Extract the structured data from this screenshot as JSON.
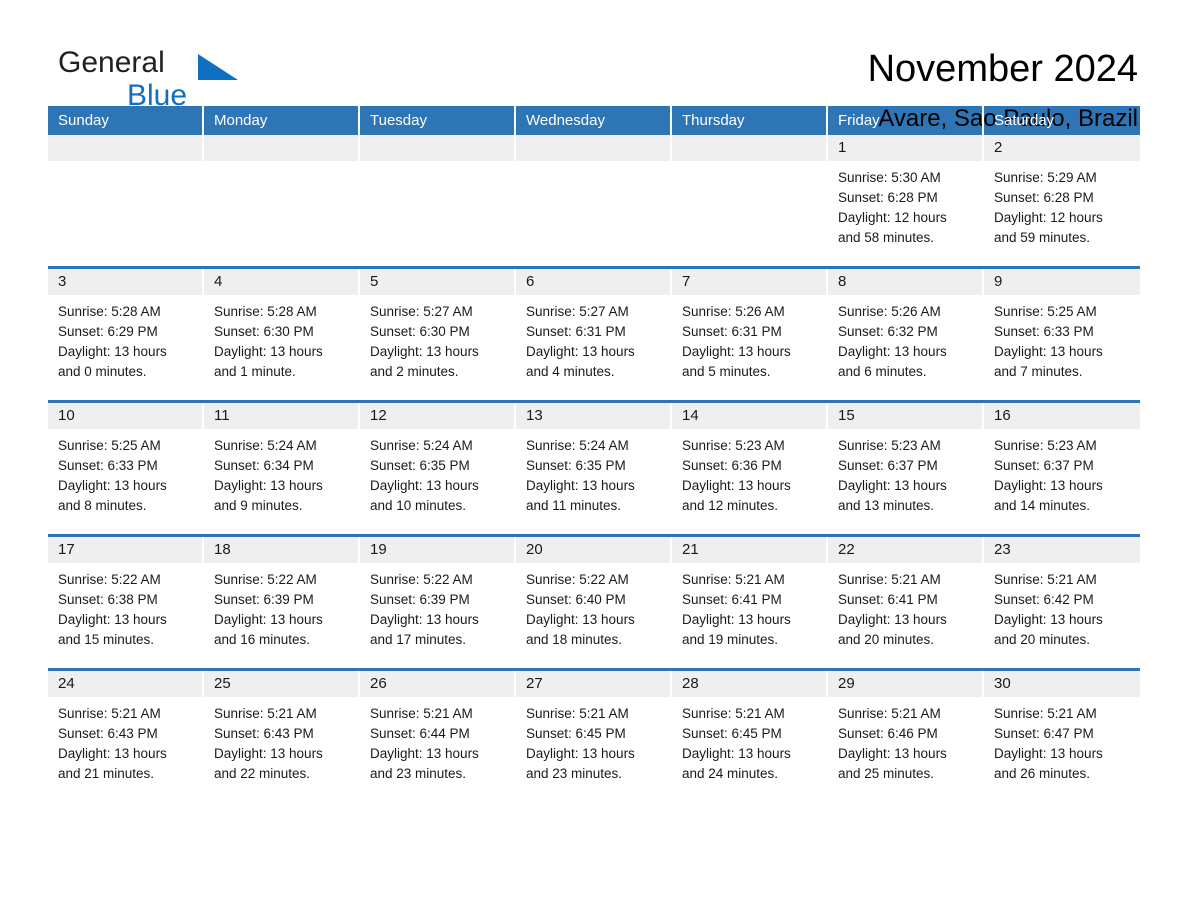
{
  "brand": {
    "name_part1": "General",
    "name_part2": "Blue",
    "triangle_color": "#0f6fc0"
  },
  "header": {
    "title": "November 2024",
    "subtitle": "Avare, Sao Paulo, Brazil"
  },
  "theme": {
    "header_bg": "#2e75b6",
    "header_text": "#ffffff",
    "daynum_bg": "#efefef",
    "row_divider": "#2e75b6",
    "cell_bg": "#ffffff"
  },
  "weekday_headers": [
    "Sunday",
    "Monday",
    "Tuesday",
    "Wednesday",
    "Thursday",
    "Friday",
    "Saturday"
  ],
  "labels": {
    "sunrise_prefix": "Sunrise:",
    "sunset_prefix": "Sunset:",
    "daylight_prefix": "Daylight:"
  },
  "weeks": [
    [
      {
        "day": "",
        "lines": []
      },
      {
        "day": "",
        "lines": []
      },
      {
        "day": "",
        "lines": []
      },
      {
        "day": "",
        "lines": []
      },
      {
        "day": "",
        "lines": []
      },
      {
        "day": "1",
        "lines": [
          "Sunrise: 5:30 AM",
          "Sunset: 6:28 PM",
          "Daylight: 12 hours",
          "and 58 minutes."
        ]
      },
      {
        "day": "2",
        "lines": [
          "Sunrise: 5:29 AM",
          "Sunset: 6:28 PM",
          "Daylight: 12 hours",
          "and 59 minutes."
        ]
      }
    ],
    [
      {
        "day": "3",
        "lines": [
          "Sunrise: 5:28 AM",
          "Sunset: 6:29 PM",
          "Daylight: 13 hours",
          "and 0 minutes."
        ]
      },
      {
        "day": "4",
        "lines": [
          "Sunrise: 5:28 AM",
          "Sunset: 6:30 PM",
          "Daylight: 13 hours",
          "and 1 minute."
        ]
      },
      {
        "day": "5",
        "lines": [
          "Sunrise: 5:27 AM",
          "Sunset: 6:30 PM",
          "Daylight: 13 hours",
          "and 2 minutes."
        ]
      },
      {
        "day": "6",
        "lines": [
          "Sunrise: 5:27 AM",
          "Sunset: 6:31 PM",
          "Daylight: 13 hours",
          "and 4 minutes."
        ]
      },
      {
        "day": "7",
        "lines": [
          "Sunrise: 5:26 AM",
          "Sunset: 6:31 PM",
          "Daylight: 13 hours",
          "and 5 minutes."
        ]
      },
      {
        "day": "8",
        "lines": [
          "Sunrise: 5:26 AM",
          "Sunset: 6:32 PM",
          "Daylight: 13 hours",
          "and 6 minutes."
        ]
      },
      {
        "day": "9",
        "lines": [
          "Sunrise: 5:25 AM",
          "Sunset: 6:33 PM",
          "Daylight: 13 hours",
          "and 7 minutes."
        ]
      }
    ],
    [
      {
        "day": "10",
        "lines": [
          "Sunrise: 5:25 AM",
          "Sunset: 6:33 PM",
          "Daylight: 13 hours",
          "and 8 minutes."
        ]
      },
      {
        "day": "11",
        "lines": [
          "Sunrise: 5:24 AM",
          "Sunset: 6:34 PM",
          "Daylight: 13 hours",
          "and 9 minutes."
        ]
      },
      {
        "day": "12",
        "lines": [
          "Sunrise: 5:24 AM",
          "Sunset: 6:35 PM",
          "Daylight: 13 hours",
          "and 10 minutes."
        ]
      },
      {
        "day": "13",
        "lines": [
          "Sunrise: 5:24 AM",
          "Sunset: 6:35 PM",
          "Daylight: 13 hours",
          "and 11 minutes."
        ]
      },
      {
        "day": "14",
        "lines": [
          "Sunrise: 5:23 AM",
          "Sunset: 6:36 PM",
          "Daylight: 13 hours",
          "and 12 minutes."
        ]
      },
      {
        "day": "15",
        "lines": [
          "Sunrise: 5:23 AM",
          "Sunset: 6:37 PM",
          "Daylight: 13 hours",
          "and 13 minutes."
        ]
      },
      {
        "day": "16",
        "lines": [
          "Sunrise: 5:23 AM",
          "Sunset: 6:37 PM",
          "Daylight: 13 hours",
          "and 14 minutes."
        ]
      }
    ],
    [
      {
        "day": "17",
        "lines": [
          "Sunrise: 5:22 AM",
          "Sunset: 6:38 PM",
          "Daylight: 13 hours",
          "and 15 minutes."
        ]
      },
      {
        "day": "18",
        "lines": [
          "Sunrise: 5:22 AM",
          "Sunset: 6:39 PM",
          "Daylight: 13 hours",
          "and 16 minutes."
        ]
      },
      {
        "day": "19",
        "lines": [
          "Sunrise: 5:22 AM",
          "Sunset: 6:39 PM",
          "Daylight: 13 hours",
          "and 17 minutes."
        ]
      },
      {
        "day": "20",
        "lines": [
          "Sunrise: 5:22 AM",
          "Sunset: 6:40 PM",
          "Daylight: 13 hours",
          "and 18 minutes."
        ]
      },
      {
        "day": "21",
        "lines": [
          "Sunrise: 5:21 AM",
          "Sunset: 6:41 PM",
          "Daylight: 13 hours",
          "and 19 minutes."
        ]
      },
      {
        "day": "22",
        "lines": [
          "Sunrise: 5:21 AM",
          "Sunset: 6:41 PM",
          "Daylight: 13 hours",
          "and 20 minutes."
        ]
      },
      {
        "day": "23",
        "lines": [
          "Sunrise: 5:21 AM",
          "Sunset: 6:42 PM",
          "Daylight: 13 hours",
          "and 20 minutes."
        ]
      }
    ],
    [
      {
        "day": "24",
        "lines": [
          "Sunrise: 5:21 AM",
          "Sunset: 6:43 PM",
          "Daylight: 13 hours",
          "and 21 minutes."
        ]
      },
      {
        "day": "25",
        "lines": [
          "Sunrise: 5:21 AM",
          "Sunset: 6:43 PM",
          "Daylight: 13 hours",
          "and 22 minutes."
        ]
      },
      {
        "day": "26",
        "lines": [
          "Sunrise: 5:21 AM",
          "Sunset: 6:44 PM",
          "Daylight: 13 hours",
          "and 23 minutes."
        ]
      },
      {
        "day": "27",
        "lines": [
          "Sunrise: 5:21 AM",
          "Sunset: 6:45 PM",
          "Daylight: 13 hours",
          "and 23 minutes."
        ]
      },
      {
        "day": "28",
        "lines": [
          "Sunrise: 5:21 AM",
          "Sunset: 6:45 PM",
          "Daylight: 13 hours",
          "and 24 minutes."
        ]
      },
      {
        "day": "29",
        "lines": [
          "Sunrise: 5:21 AM",
          "Sunset: 6:46 PM",
          "Daylight: 13 hours",
          "and 25 minutes."
        ]
      },
      {
        "day": "30",
        "lines": [
          "Sunrise: 5:21 AM",
          "Sunset: 6:47 PM",
          "Daylight: 13 hours",
          "and 26 minutes."
        ]
      }
    ]
  ]
}
